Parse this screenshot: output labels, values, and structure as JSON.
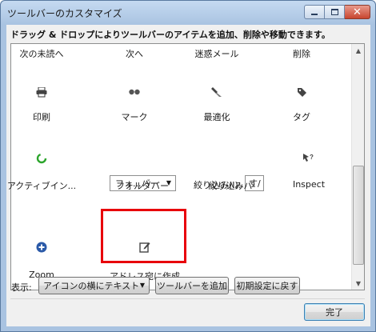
{
  "window": {
    "title": "ツールバーのカスタマイズ",
    "instruction": "ドラッグ & ドロップによりツールバーのアイテムを追加、削除や移動できます。"
  },
  "palette": {
    "row1": [
      "次の未読へ",
      "次へ",
      "迷惑メール",
      "削除"
    ],
    "row2": [
      "印刷",
      "マーク",
      "最適化",
      "タグ"
    ],
    "row3": {
      "activity": "アクティブイン...",
      "folder_dropdown": "フォ...バー",
      "folder_label": "フォルダバー",
      "filter_field_label": "絞り込み(I):",
      "filter_field_value": "す/",
      "filter_label": "絞り込みバ-",
      "inspect": "Inspect"
    },
    "row4": [
      "Zoom",
      "アドレス宛に作成"
    ],
    "icons": {
      "row2": [
        "printer-icon",
        "mark-icon",
        "compact-icon",
        "tag-icon"
      ],
      "row3": [
        "activity-icon",
        "inspect-icon"
      ],
      "row4": [
        "zoom-icon",
        "compose-icon"
      ]
    }
  },
  "footer": {
    "show_label": "表示:",
    "show_value": "アイコンの横にテキスト",
    "add_toolbar": "ツールバーを追加",
    "restore_default": "初期設定に戻す",
    "done": "完了"
  },
  "colors": {
    "highlight": "#e8000b",
    "activity_green": "#2ca52c",
    "zoom_blue": "#2b5aa8"
  }
}
